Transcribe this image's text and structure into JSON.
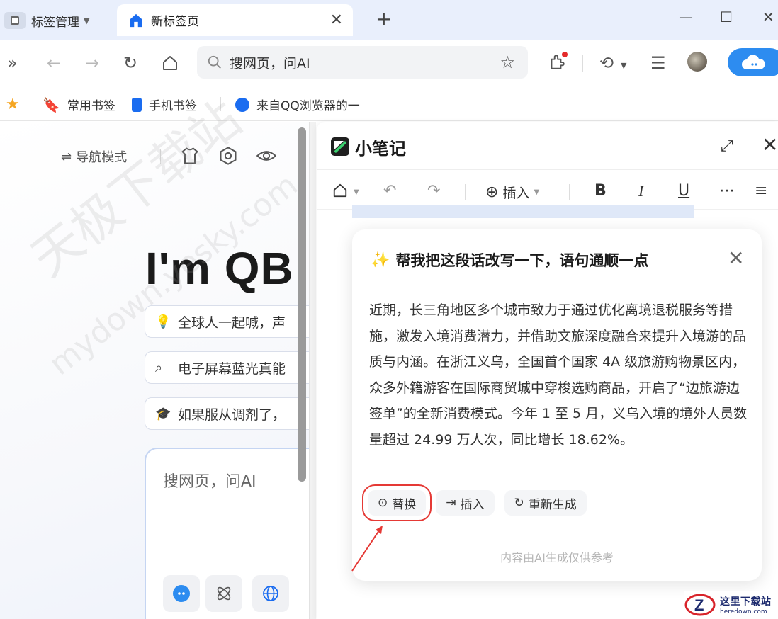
{
  "tabs": {
    "group_label": "标签管理",
    "active_label": "新标签页"
  },
  "toolbar": {
    "search_placeholder": "搜网页，问AI"
  },
  "bookmarks": [
    {
      "label": "常用书签"
    },
    {
      "label": "手机书签"
    },
    {
      "label": "来自QQ浏览器的一"
    }
  ],
  "left_page": {
    "nav_mode_label": "导航模式",
    "title": "I'm QB",
    "suggestions": [
      {
        "icon": "lightbulb-icon",
        "text": "全球人一起喊，声"
      },
      {
        "icon": "search-icon",
        "text": "电子屏幕蓝光真能"
      },
      {
        "icon": "graduation-cap-icon",
        "text": "如果服从调剂了，"
      }
    ],
    "input_placeholder": "搜网页，问AI"
  },
  "notes_panel": {
    "title": "小笔记",
    "insert_label": "插入"
  },
  "ai_card": {
    "title": "帮我把这段话改写一下，语句通顺一点",
    "body": "近期，长三角地区多个城市致力于通过优化离境退税服务等措施，激发入境消费潜力，并借助文旅深度融合来提升入境游的品质与内涵。在浙江义乌，全国首个国家 4A 级旅游购物景区内，众多外籍游客在国际商贸城中穿梭选购商品，开启了“边旅游边签单”的全新消费模式。今年 1 至 5 月，义乌入境的境外人员数量超过 24.99 万人次，同比增长 18.62%。",
    "actions": {
      "replace": "替换",
      "insert": "插入",
      "regenerate": "重新生成"
    },
    "footer": "内容由AI生成仅供参考"
  },
  "watermark": {
    "cn": "天极下载站",
    "en": "mydown.yesky.com"
  },
  "site_logo": {
    "cn": "这里下载站",
    "en": "heredown.com"
  },
  "colors": {
    "accent": "#2d8cf0",
    "highlight_box": "#e53935",
    "tabbar_bg": "#e9effc"
  }
}
